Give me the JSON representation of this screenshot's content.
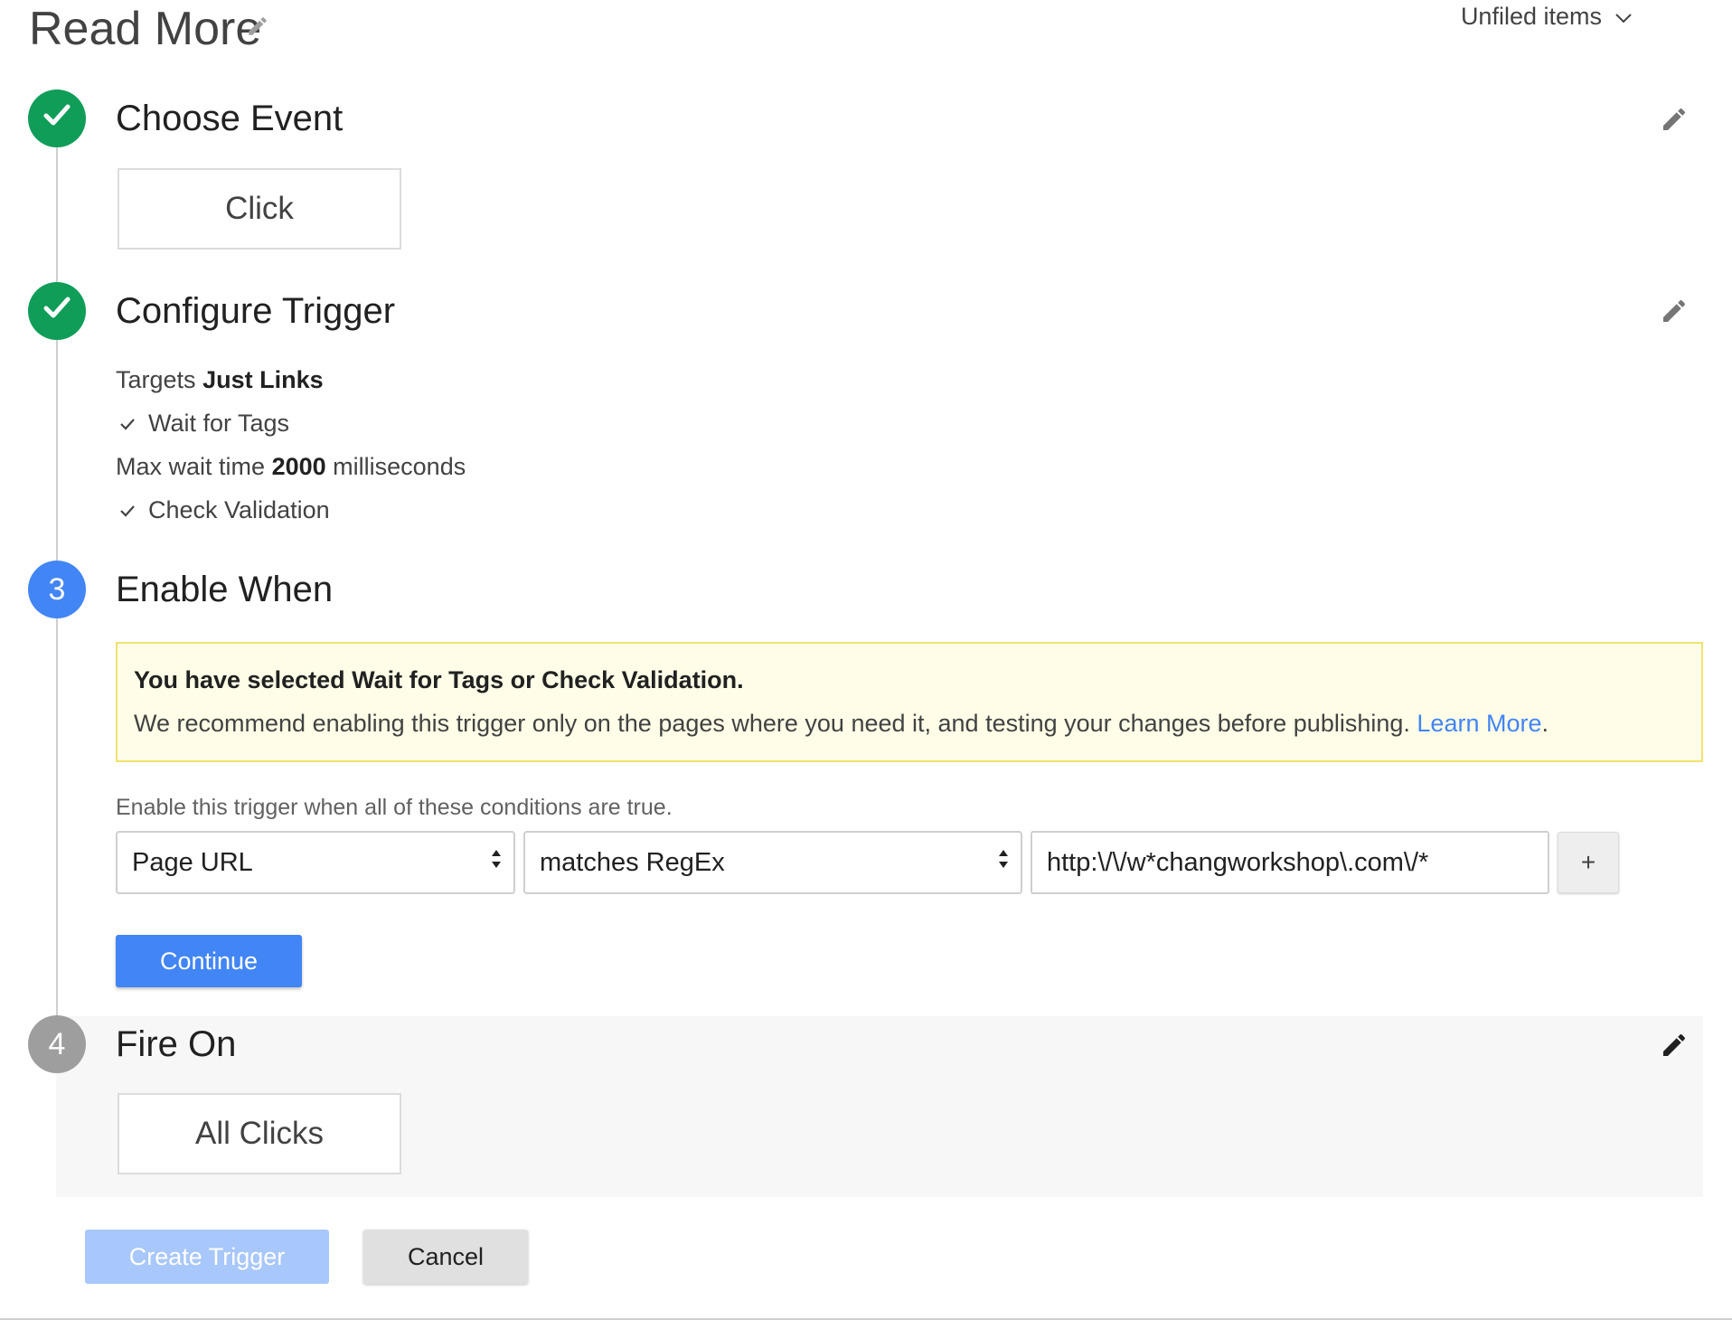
{
  "header": {
    "title": "Read More",
    "folder": "Unfiled items"
  },
  "steps": {
    "choose_event": {
      "title": "Choose Event",
      "value": "Click"
    },
    "configure_trigger": {
      "title": "Configure Trigger",
      "targets_label": "Targets",
      "targets_value": "Just Links",
      "wait_for_tags": "Wait for Tags",
      "max_wait_label": "Max wait time",
      "max_wait_value": "2000",
      "max_wait_unit": "milliseconds",
      "check_validation": "Check Validation"
    },
    "enable_when": {
      "number": "3",
      "title": "Enable When",
      "warning_title": "You have selected Wait for Tags or Check Validation.",
      "warning_body": "We recommend enabling this trigger only on the pages where you need it, and testing your changes before publishing.",
      "learn_more": "Learn More",
      "period": ".",
      "conditions_label": "Enable this trigger when all of these conditions are true.",
      "condition": {
        "variable": "Page URL",
        "operator": "matches RegEx",
        "value": "http:\\/\\/w*changworkshop\\.com\\/*"
      },
      "add_label": "+",
      "continue_label": "Continue"
    },
    "fire_on": {
      "number": "4",
      "title": "Fire On",
      "value": "All Clicks"
    }
  },
  "footer": {
    "create_label": "Create Trigger",
    "cancel_label": "Cancel"
  },
  "colors": {
    "done": "#0f9d58",
    "active": "#4285f4",
    "pending": "#9e9e9e",
    "link": "#4285f4",
    "warning_bg": "#fffde7",
    "warning_border": "#f0e270"
  },
  "icons": {
    "title_edit": "pencil-icon",
    "folder_dropdown": "chevron-down-icon",
    "step_done": "check-icon",
    "step_edit": "pencil-icon",
    "select_arrows": "sort-arrows-icon"
  }
}
